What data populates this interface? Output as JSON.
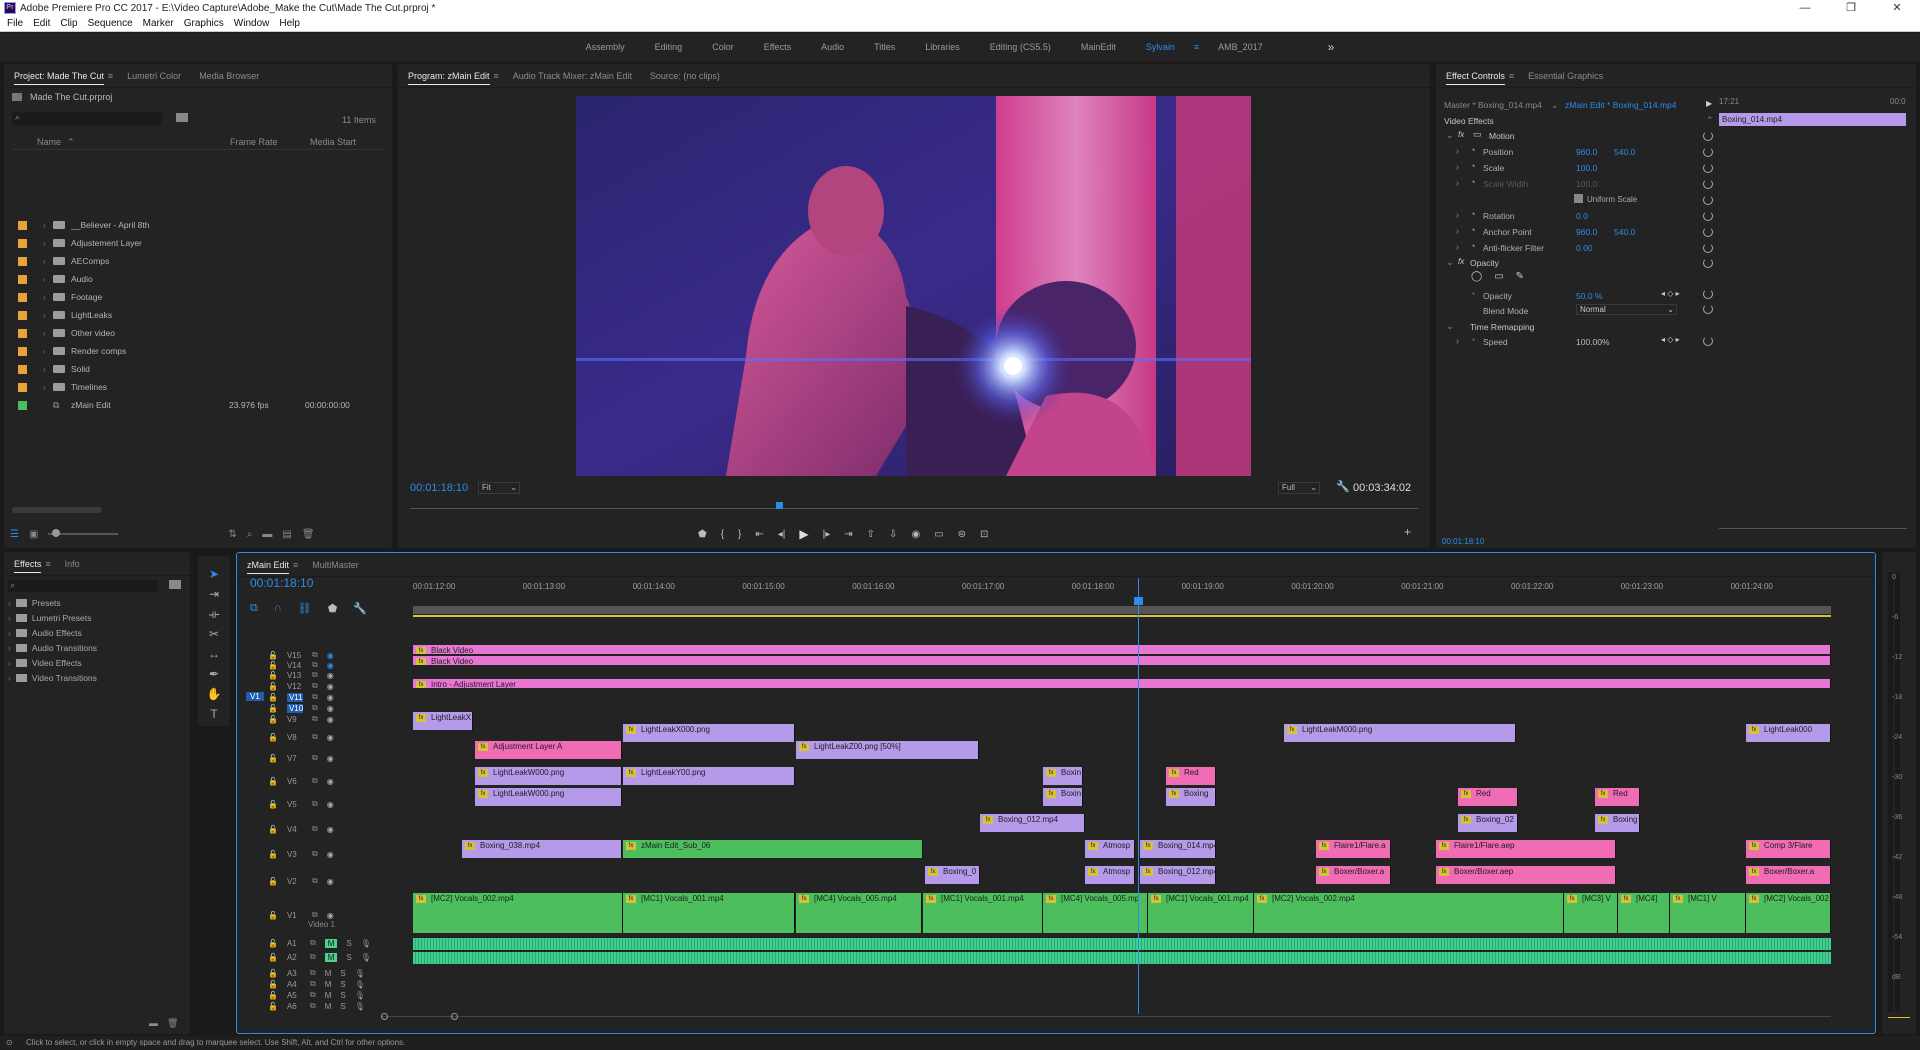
{
  "titlebar": {
    "text": "Adobe Premiere Pro CC 2017 - E:\\Video Capture\\Adobe_Make the Cut\\Made The Cut.prproj *",
    "min": "—",
    "max": "❐",
    "close": "✕"
  },
  "menu": [
    "File",
    "Edit",
    "Clip",
    "Sequence",
    "Marker",
    "Graphics",
    "Window",
    "Help"
  ],
  "workspaces": [
    "Assembly",
    "Editing",
    "Color",
    "Effects",
    "Audio",
    "Titles",
    "Libraries",
    "Editing (CS5.5)",
    "MainEdit",
    "Sylvain",
    "AMB_2017"
  ],
  "workspace_more": "»",
  "project_panel": {
    "tabs": [
      "Project: Made The Cut",
      "Lumetri Color",
      "Media Browser"
    ],
    "project_file": "Made The Cut.prproj",
    "items_count": "11 Items",
    "columns": [
      "Name",
      "Frame Rate",
      "Media Start"
    ],
    "items": [
      {
        "name": "__Believer - April 8th",
        "color": "#e8a33a",
        "rate": "",
        "start": ""
      },
      {
        "name": "Adjustement Layer",
        "color": "#e8a33a",
        "rate": "",
        "start": ""
      },
      {
        "name": "AEComps",
        "color": "#e8a33a",
        "rate": "",
        "start": ""
      },
      {
        "name": "Audio",
        "color": "#e8a33a",
        "rate": "",
        "start": ""
      },
      {
        "name": "Footage",
        "color": "#e8a33a",
        "rate": "",
        "start": ""
      },
      {
        "name": "LightLeaks",
        "color": "#e8a33a",
        "rate": "",
        "start": ""
      },
      {
        "name": "Other video",
        "color": "#e8a33a",
        "rate": "",
        "start": ""
      },
      {
        "name": "Render comps",
        "color": "#e8a33a",
        "rate": "",
        "start": ""
      },
      {
        "name": "Solid",
        "color": "#e8a33a",
        "rate": "",
        "start": ""
      },
      {
        "name": "Timelines",
        "color": "#e8a33a",
        "rate": "",
        "start": ""
      },
      {
        "name": "zMain Edit",
        "color": "#4dbe5e",
        "rate": "23.976 fps",
        "start": "00:00:00:00"
      }
    ]
  },
  "program_monitor": {
    "tabs": [
      "Program: zMain Edit",
      "Audio Track Mixer: zMain Edit",
      "Source: (no clips)"
    ],
    "timecode": "00:01:18:10",
    "fit": "Fit",
    "quality": "Full",
    "duration": "00:03:34:02",
    "playhead_fraction": 0.363
  },
  "effect_controls": {
    "tabs": [
      "Effect Controls",
      "Essential Graphics"
    ],
    "master": "Master * Boxing_014.mp4",
    "sequence": "zMain Edit * Boxing_014.mp4",
    "time_start": "17:21",
    "time_end": "00:0",
    "clip_name": "Boxing_014.mp4",
    "section": "Video Effects",
    "motion": "Motion",
    "props": [
      {
        "name": "Position",
        "v1": "960.0",
        "v2": "540.0"
      },
      {
        "name": "Scale",
        "v1": "100.0",
        "v2": ""
      },
      {
        "name": "Scale Width",
        "v1": "100.0",
        "v2": ""
      },
      {
        "name": "Rotation",
        "v1": "0.0",
        "v2": ""
      },
      {
        "name": "Anchor Point",
        "v1": "960.0",
        "v2": "540.0"
      },
      {
        "name": "Anti-flicker Filter",
        "v1": "0.00",
        "v2": ""
      }
    ],
    "uniform_scale": "Uniform Scale",
    "opacity_section": "Opacity",
    "opacity_label": "Opacity",
    "opacity_value": "50.0 %",
    "blend_label": "Blend Mode",
    "blend_value": "Normal",
    "time_remap": "Time Remapping",
    "speed_label": "Speed",
    "speed_value": "100.00%",
    "bottom_timecode": "00:01:18:10"
  },
  "effects_panel": {
    "tabs": [
      "Effects",
      "Info"
    ],
    "items": [
      "Presets",
      "Lumetri Presets",
      "Audio Effects",
      "Audio Transitions",
      "Video Effects",
      "Video Transitions"
    ]
  },
  "timeline": {
    "tabs": [
      "zMain Edit",
      "MultiMaster"
    ],
    "timecode": "00:01:18:10",
    "ruler": [
      "00:01:12:00",
      "00:01:13:00",
      "00:01:14:00",
      "00:01:15:00",
      "00:01:16:00",
      "00:01:17:00",
      "00:01:18:00",
      "00:01:19:00",
      "00:01:20:00",
      "00:01:21:00",
      "00:01:22:00",
      "00:01:23:00",
      "00:01:24:00"
    ],
    "video_tracks": [
      "V15",
      "V14",
      "V13",
      "V12",
      "V11",
      "V10",
      "V9",
      "V8",
      "V7",
      "V6",
      "V5",
      "V4",
      "V3",
      "V2",
      "V1"
    ],
    "audio_tracks": [
      "A1",
      "A2",
      "A3",
      "A4",
      "A5",
      "A6"
    ],
    "src_patch": "V1",
    "track_name_v1": "Video 1",
    "clips": [
      {
        "label": "Black Video",
        "cls": "p"
      },
      {
        "label": "Black Video",
        "cls": "p"
      },
      {
        "label": "Intro - Adjustment Layer",
        "cls": "p"
      },
      {
        "label": "LightLeakX",
        "cls": "v"
      },
      {
        "label": "LightLeakX000.png",
        "cls": "v"
      },
      {
        "label": "LightLeakM000.png",
        "cls": "v"
      },
      {
        "label": "LightLeak000",
        "cls": "v"
      },
      {
        "label": "Adjustment Layer A",
        "cls": "pk"
      },
      {
        "label": "LightLeakZ00.png [50%]",
        "cls": "v"
      },
      {
        "label": "LightLeakW000.png",
        "cls": "v"
      },
      {
        "label": "LightLeakY00.png",
        "cls": "v"
      },
      {
        "label": "Boxin",
        "cls": "v"
      },
      {
        "label": "Red",
        "cls": "pk"
      },
      {
        "label": "LightLeakW000.png",
        "cls": "v"
      },
      {
        "label": "Boxin",
        "cls": "v"
      },
      {
        "label": "Boxing",
        "cls": "v"
      },
      {
        "label": "Red",
        "cls": "pk"
      },
      {
        "label": "Red",
        "cls": "pk"
      },
      {
        "label": "Boxing_012.mp4",
        "cls": "v"
      },
      {
        "label": "Boxing_02",
        "cls": "v"
      },
      {
        "label": "Boxing",
        "cls": "v"
      },
      {
        "label": "Boxing_038.mp4",
        "cls": "v"
      },
      {
        "label": "zMain Edit_Sub_06",
        "cls": "g"
      },
      {
        "label": "Atmosp",
        "cls": "v"
      },
      {
        "label": "Boxing_014.mp4",
        "cls": "v"
      },
      {
        "label": "Flaire1/Flare.a",
        "cls": "pk"
      },
      {
        "label": "Flaire1/Flare.aep",
        "cls": "pk"
      },
      {
        "label": "Comp 3/Flare",
        "cls": "pk"
      },
      {
        "label": "Boxing_0",
        "cls": "v"
      },
      {
        "label": "Atmosp",
        "cls": "v"
      },
      {
        "label": "Boxing_012.mp4",
        "cls": "v"
      },
      {
        "label": "Boxer/Boxer.a",
        "cls": "pk"
      },
      {
        "label": "Boxer/Boxer.aep",
        "cls": "pk"
      },
      {
        "label": "Boxer/Boxer.a",
        "cls": "pk"
      },
      {
        "label": "[MC2] Vocals_002.mp4",
        "cls": "g"
      },
      {
        "label": "[MC1] Vocals_001.mp4",
        "cls": "g"
      },
      {
        "label": "[MC4] Vocals_005.mp4",
        "cls": "g"
      },
      {
        "label": "[MC1] Vocals_001.mp4",
        "cls": "g"
      },
      {
        "label": "[MC4] Vocals_005.mp",
        "cls": "g"
      },
      {
        "label": "[MC1] Vocals_001.mp4",
        "cls": "g"
      },
      {
        "label": "[MC2] Vocals_002.mp4",
        "cls": "g"
      },
      {
        "label": "[MC3] V",
        "cls": "g"
      },
      {
        "label": "[MC4]",
        "cls": "g"
      },
      {
        "label": "[MC1] V",
        "cls": "g"
      },
      {
        "label": "[MC2] Vocals_002.mp4",
        "cls": "g"
      }
    ],
    "meter_labels": [
      "0",
      "-6",
      "-12",
      "-18",
      "-24",
      "-30",
      "-36",
      "-42",
      "-48",
      "-54",
      "dB"
    ]
  },
  "status_bar": "Click to select, or click in empty space and drag to marquee select. Use Shift, Alt, and Ctrl for other options."
}
